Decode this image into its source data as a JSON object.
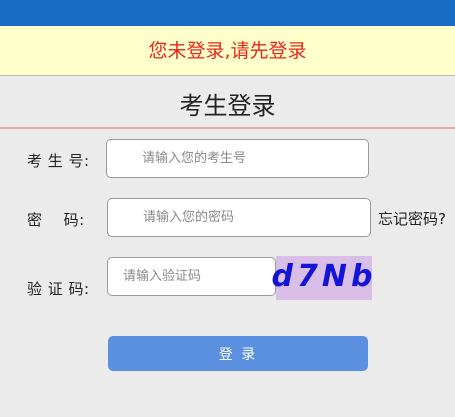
{
  "notice": {
    "text": "您未登录,请先登录"
  },
  "page_title": "考生登录",
  "form": {
    "candidate_id": {
      "label": "考 生 号:",
      "placeholder": "请输入您的考生号",
      "value": ""
    },
    "password": {
      "label": "密    码:",
      "placeholder": "请输入您的密码",
      "value": ""
    },
    "forgot_password": "忘记密码?",
    "captcha": {
      "label": "验 证 码:",
      "placeholder": "请输入验证码",
      "value": "",
      "image_text": "d7Nb"
    },
    "login_button": "登 录"
  },
  "colors": {
    "topbar": "#1a6bc4",
    "notice_bg": "#ffffcc",
    "notice_text": "#e8261c",
    "title_divider": "#f2a6a6",
    "captcha_bg": "#d9bfe8",
    "captcha_text": "#1414d6",
    "button_bg": "#5b8fe0"
  }
}
